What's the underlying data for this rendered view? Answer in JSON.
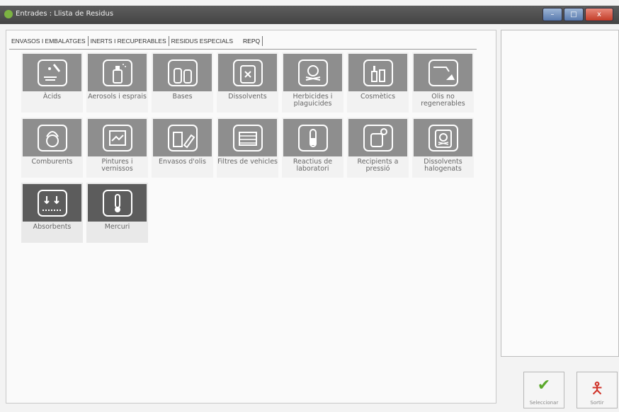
{
  "window": {
    "title": "Entrades : Llista de Residus",
    "controls": {
      "minimize": "–",
      "maximize": "□",
      "close": "x"
    }
  },
  "tabs": [
    {
      "label": "ENVASOS I EMBALATGES"
    },
    {
      "label": "INERTS I RECUPERABLES"
    },
    {
      "label": "RESIDUS ESPECIALS"
    },
    {
      "label": "REPQ",
      "active": true
    }
  ],
  "tiles": [
    {
      "label": "Àcids",
      "icon": "acid-icon"
    },
    {
      "label": "Aerosols i esprais",
      "icon": "aerosol-icon"
    },
    {
      "label": "Bases",
      "icon": "bases-icon"
    },
    {
      "label": "Dissolvents",
      "icon": "solvent-icon"
    },
    {
      "label": "Herbicides i plaguicides",
      "icon": "skull-icon"
    },
    {
      "label": "Cosmètics",
      "icon": "cosmetics-icon"
    },
    {
      "label": "Olis no regenerables",
      "icon": "oil-pour-icon"
    },
    {
      "label": "Comburents",
      "icon": "flame-icon"
    },
    {
      "label": "Pintures i vernissos",
      "icon": "paint-icon"
    },
    {
      "label": "Envasos d'olis",
      "icon": "oil-containers-icon"
    },
    {
      "label": "Filtres de vehicles",
      "icon": "filter-icon"
    },
    {
      "label": "Reactius de laboratori",
      "icon": "test-tube-icon"
    },
    {
      "label": "Recipients a pressió",
      "icon": "gas-cylinder-icon"
    },
    {
      "label": "Dissolvents halogenats",
      "icon": "halogenated-skull-icon"
    },
    {
      "label": "Absorbents",
      "icon": "absorbent-icon",
      "selected": true
    },
    {
      "label": "Mercuri",
      "icon": "thermometer-icon",
      "selected": true
    }
  ],
  "actions": {
    "select": {
      "label": "Seleccionar",
      "icon": "checkmark-icon"
    },
    "exit": {
      "label": "Sortir",
      "icon": "person-exit-icon"
    }
  }
}
